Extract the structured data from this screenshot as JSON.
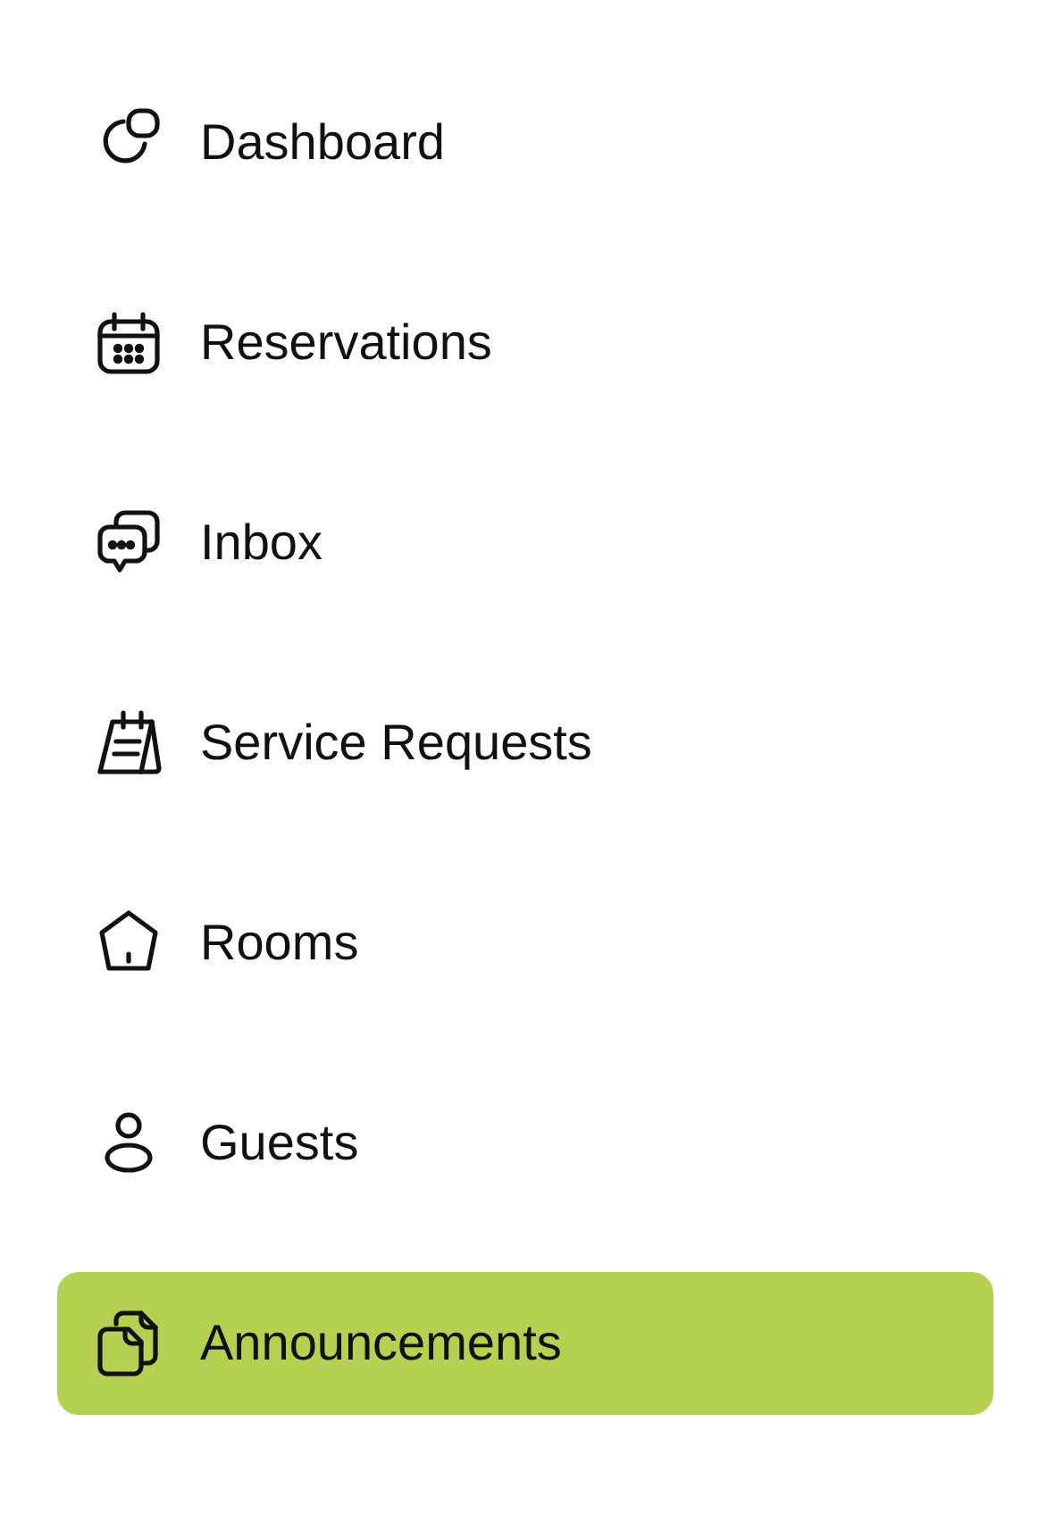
{
  "sidebar": {
    "items": [
      {
        "label": "Dashboard",
        "selected": false
      },
      {
        "label": "Reservations",
        "selected": false
      },
      {
        "label": "Inbox",
        "selected": false
      },
      {
        "label": "Service Requests",
        "selected": false
      },
      {
        "label": "Rooms",
        "selected": false
      },
      {
        "label": "Guests",
        "selected": false
      },
      {
        "label": "Announcements",
        "selected": true
      }
    ]
  }
}
